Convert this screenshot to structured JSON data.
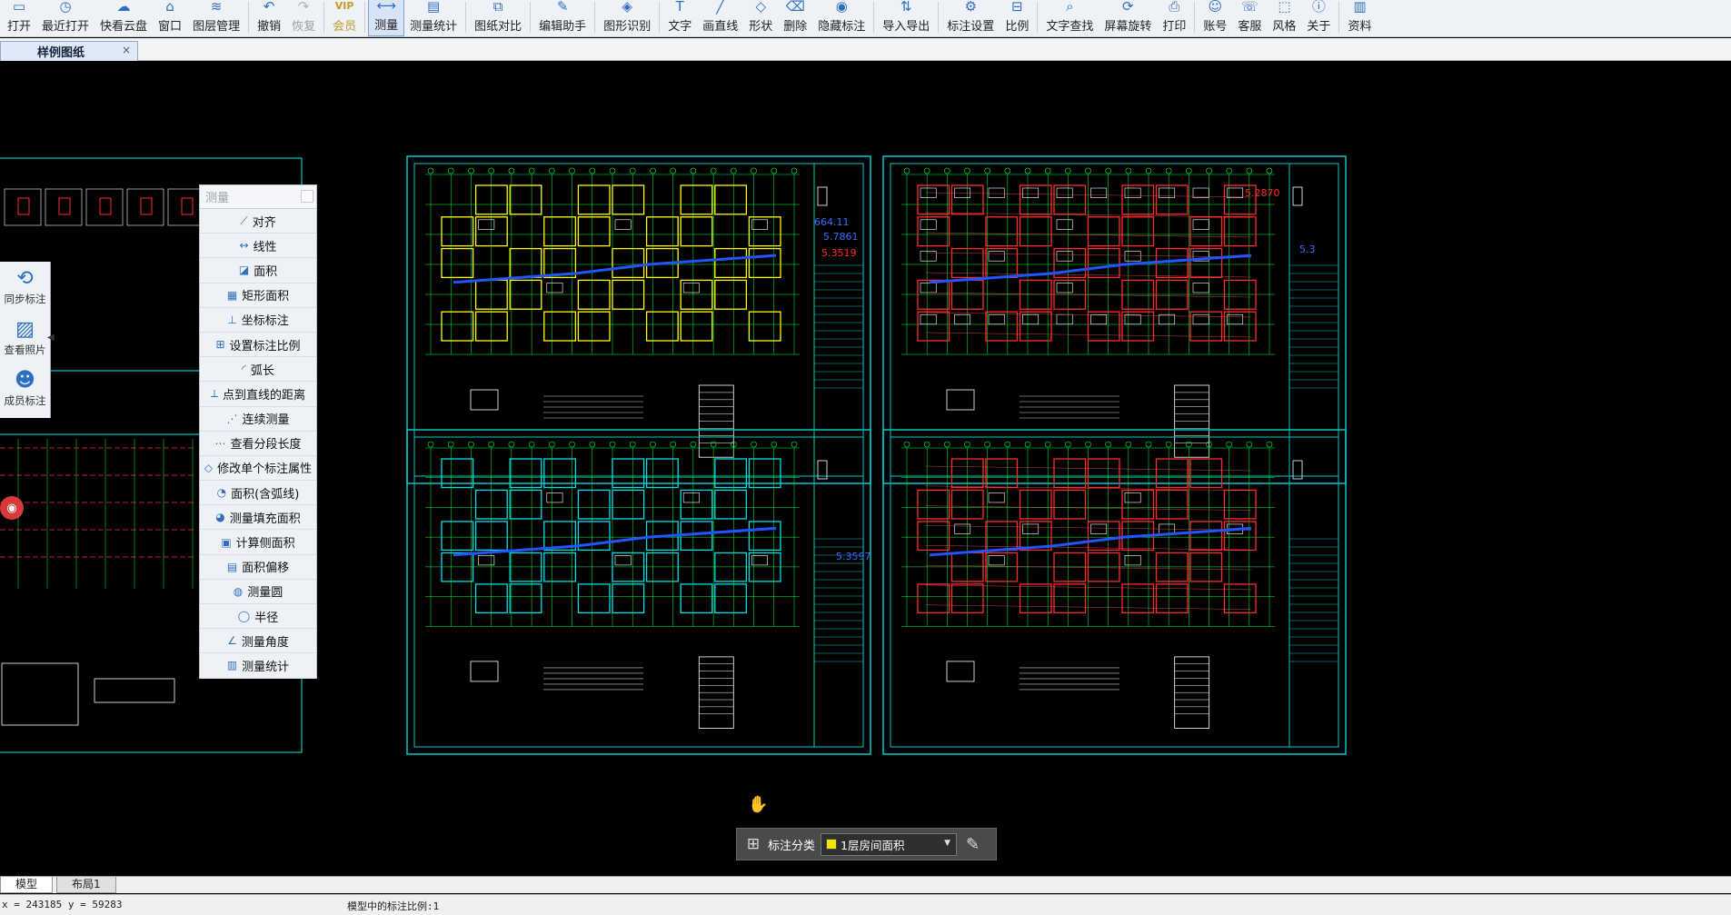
{
  "toolbar": {
    "items": [
      {
        "label": "打开",
        "icon": "folder-open-icon",
        "glyph": "▭"
      },
      {
        "label": "最近打开",
        "icon": "clock-icon",
        "glyph": "◷"
      },
      {
        "label": "快看云盘",
        "icon": "cloud-icon",
        "glyph": "☁"
      },
      {
        "label": "窗口",
        "icon": "window-icon",
        "glyph": "⌂"
      },
      {
        "label": "图层管理",
        "icon": "layers-icon",
        "glyph": "≋"
      },
      {
        "label": "撤销",
        "icon": "undo-icon",
        "glyph": "↶"
      },
      {
        "label": "恢复",
        "icon": "redo-icon",
        "glyph": "↷"
      },
      {
        "label": "会员",
        "icon": "vip-icon",
        "glyph": "VIP"
      },
      {
        "label": "测量",
        "icon": "ruler-icon",
        "glyph": "⟷"
      },
      {
        "label": "测量统计",
        "icon": "measure-stats-icon",
        "glyph": "▤"
      },
      {
        "label": "图纸对比",
        "icon": "compare-icon",
        "glyph": "⧉"
      },
      {
        "label": "编辑助手",
        "icon": "edit-assistant-icon",
        "glyph": "✎"
      },
      {
        "label": "图形识别",
        "icon": "shape-recognize-icon",
        "glyph": "◈"
      },
      {
        "label": "文字",
        "icon": "text-icon",
        "glyph": "T"
      },
      {
        "label": "画直线",
        "icon": "line-icon",
        "glyph": "╱"
      },
      {
        "label": "形状",
        "icon": "shape-icon",
        "glyph": "◇"
      },
      {
        "label": "删除",
        "icon": "eraser-icon",
        "glyph": "⌫"
      },
      {
        "label": "隐藏标注",
        "icon": "eye-icon",
        "glyph": "◉"
      },
      {
        "label": "导入导出",
        "icon": "import-export-icon",
        "glyph": "⇅"
      },
      {
        "label": "标注设置",
        "icon": "annotation-settings-icon",
        "glyph": "⚙"
      },
      {
        "label": "比例",
        "icon": "scale-icon",
        "glyph": "⊟"
      },
      {
        "label": "文字查找",
        "icon": "text-search-icon",
        "glyph": "⌕"
      },
      {
        "label": "屏幕旋转",
        "icon": "rotate-icon",
        "glyph": "⟳"
      },
      {
        "label": "打印",
        "icon": "printer-icon",
        "glyph": "⎙"
      },
      {
        "label": "账号",
        "icon": "user-icon",
        "glyph": "☺"
      },
      {
        "label": "客服",
        "icon": "headset-icon",
        "glyph": "☏"
      },
      {
        "label": "风格",
        "icon": "style-icon",
        "glyph": "⬚"
      },
      {
        "label": "关于",
        "icon": "info-icon",
        "glyph": "ⓘ"
      },
      {
        "label": "资料",
        "icon": "document-icon",
        "glyph": "▥"
      }
    ]
  },
  "tab": {
    "title": "样例图纸",
    "close": "×"
  },
  "side_tools": [
    {
      "label": "同步标注",
      "icon": "sync-icon",
      "glyph": "⟲"
    },
    {
      "label": "查看照片",
      "icon": "photo-icon",
      "glyph": "▨"
    },
    {
      "label": "成员标注",
      "icon": "members-icon",
      "glyph": "☻"
    }
  ],
  "measure_panel": {
    "title": "测量",
    "items": [
      {
        "label": "对齐",
        "icon": "align-icon",
        "glyph": "⟋"
      },
      {
        "label": "线性",
        "icon": "linear-icon",
        "glyph": "↔"
      },
      {
        "label": "面积",
        "icon": "area-icon",
        "glyph": "◪"
      },
      {
        "label": "矩形面积",
        "icon": "rect-area-icon",
        "glyph": "▦"
      },
      {
        "label": "坐标标注",
        "icon": "coordinate-icon",
        "glyph": "⊥"
      },
      {
        "label": "设置标注比例",
        "icon": "set-scale-icon",
        "glyph": "⊞"
      },
      {
        "label": "弧长",
        "icon": "arc-icon",
        "glyph": "◜"
      },
      {
        "label": "点到直线的距离",
        "icon": "point-line-icon",
        "glyph": "⟂"
      },
      {
        "label": "连续测量",
        "icon": "continuous-icon",
        "glyph": "⋰"
      },
      {
        "label": "查看分段长度",
        "icon": "segment-icon",
        "glyph": "⋯"
      },
      {
        "label": "修改单个标注属性",
        "icon": "modify-icon",
        "glyph": "◇"
      },
      {
        "label": "面积(含弧线)",
        "icon": "arc-area-icon",
        "glyph": "◔"
      },
      {
        "label": "测量填充面积",
        "icon": "fill-area-icon",
        "glyph": "◕"
      },
      {
        "label": "计算侧面积",
        "icon": "side-area-icon",
        "glyph": "▣"
      },
      {
        "label": "面积偏移",
        "icon": "area-offset-icon",
        "glyph": "▤"
      },
      {
        "label": "测量圆",
        "icon": "circle-icon",
        "glyph": "◍"
      },
      {
        "label": "半径",
        "icon": "radius-icon",
        "glyph": "◯"
      },
      {
        "label": "测量角度",
        "icon": "angle-icon",
        "glyph": "∠"
      },
      {
        "label": "测量统计",
        "icon": "stats-icon",
        "glyph": "▥"
      }
    ]
  },
  "annotation_bar": {
    "label": "标注分类",
    "category": "1层房间面积",
    "swatch_color": "#f2e600"
  },
  "drawing": {
    "measure_labels": [
      "664.11",
      "5.3519",
      "5.7861",
      "5.2870",
      "5.3",
      "5.3597"
    ]
  },
  "layout_tabs": [
    "模型",
    "布局1"
  ],
  "status": {
    "coords": "x = 243185 y = 59283",
    "scale": "模型中的标注比例:1"
  },
  "colors": {
    "cad_bg": "#000000",
    "frame": "#00c8c8",
    "grid": "#00ff3c",
    "red": "#ff2a2a",
    "yellow": "#ffff00",
    "blue": "#2255ff"
  }
}
